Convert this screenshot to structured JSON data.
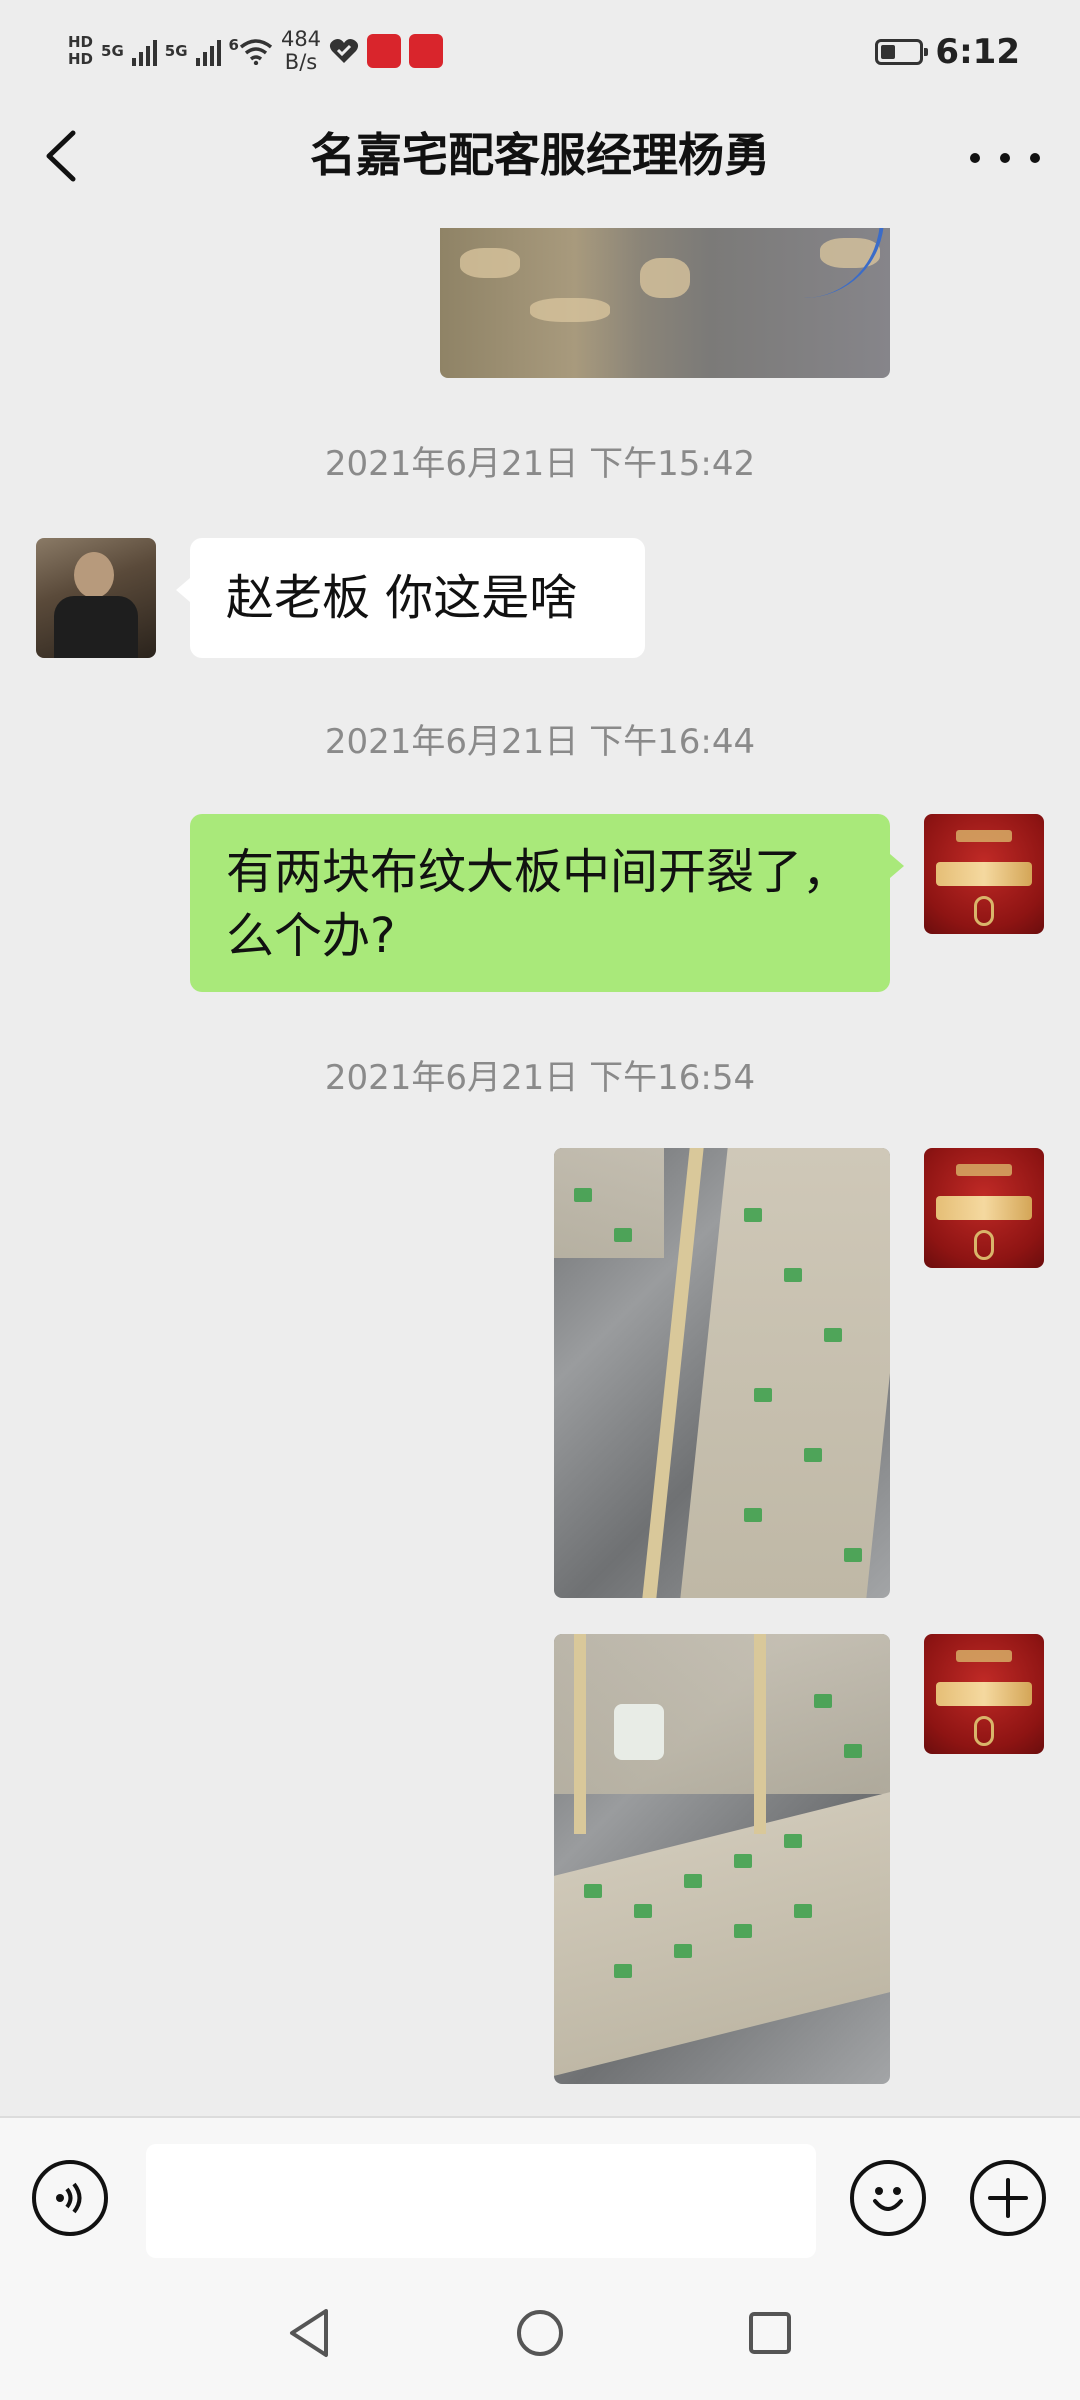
{
  "status_bar": {
    "network_label_1": "HD",
    "network_label_2": "HD",
    "signal_1": "5G",
    "signal_2": "5G",
    "wifi_gen": "6",
    "speed_value": "484",
    "speed_unit": "B/s",
    "time": "6:12",
    "icons": [
      "signal-icon",
      "wifi-icon",
      "heart-icon",
      "app-badge-icon",
      "battery-icon"
    ]
  },
  "header": {
    "title": "名嘉宅配客服经理杨勇",
    "back_icon": "chevron-left-icon",
    "more_icon": "more-icon"
  },
  "messages": [
    {
      "type": "image",
      "from": "me",
      "description_icon": "photo-icon"
    },
    {
      "type": "timestamp",
      "text": "2021年6月21日 下午15:42"
    },
    {
      "type": "text",
      "from": "other",
      "text": "赵老板 你这是啥"
    },
    {
      "type": "timestamp",
      "text": "2021年6月21日 下午16:44"
    },
    {
      "type": "text",
      "from": "me",
      "line1": "有两块布纹大板中间开裂了，",
      "line2": "么个办?"
    },
    {
      "type": "timestamp",
      "text": "2021年6月21日 下午16:54"
    },
    {
      "type": "image",
      "from": "me",
      "description_icon": "photo-icon"
    },
    {
      "type": "image",
      "from": "me",
      "description_icon": "photo-icon"
    }
  ],
  "input_bar": {
    "placeholder": "",
    "icons": [
      "voice-icon",
      "emoji-icon",
      "plus-icon"
    ]
  },
  "nav_bar": {
    "icons": [
      "back-triangle-icon",
      "home-circle-icon",
      "recents-square-icon"
    ]
  },
  "colors": {
    "background": "#ededed",
    "my_bubble": "#a9e97a",
    "their_bubble": "#ffffff",
    "timestamp": "#8a8a8a"
  }
}
